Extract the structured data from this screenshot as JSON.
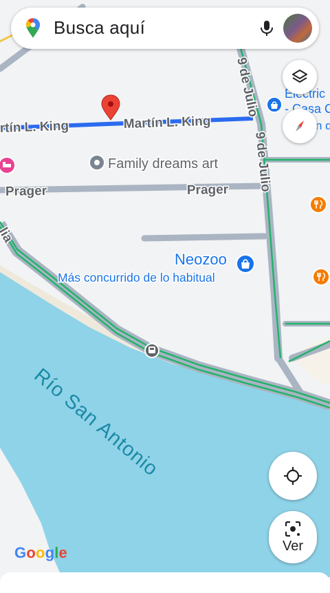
{
  "search": {
    "placeholder": "Busca aquí"
  },
  "map": {
    "streets": {
      "martin_king_left": "rtín L. King",
      "martin_king_right": "Martín L. King",
      "prager_left": "Prager",
      "prager_right": "Prager",
      "nueve_julio_top": "9 de Julio",
      "nueve_julio_bottom": "9 de Julio",
      "edge_label": "lia"
    },
    "places": {
      "family_dreams": "Family dreams art",
      "neozoo_name": "Neozoo",
      "neozoo_status": "Más concurrido de lo habitual",
      "electric_line1": "Electric",
      "electric_line2": "- Casa C",
      "edge_place": "n de"
    },
    "river": "Río San Antonio",
    "colors": {
      "water": "#8fd3e8",
      "land": "#f1f3f4",
      "road": "#aab4c3",
      "traffic_green": "#24b36b",
      "route_blue": "#2b6bf0",
      "pin_red": "#ea4335",
      "poi_blue": "#1a73e8",
      "food_orange": "#f57c00",
      "hotel_pink": "#e84393"
    }
  },
  "controls": {
    "ver_label": "Ver"
  },
  "brand": {
    "google_letters": [
      "G",
      "o",
      "o",
      "g",
      "l",
      "e"
    ]
  }
}
